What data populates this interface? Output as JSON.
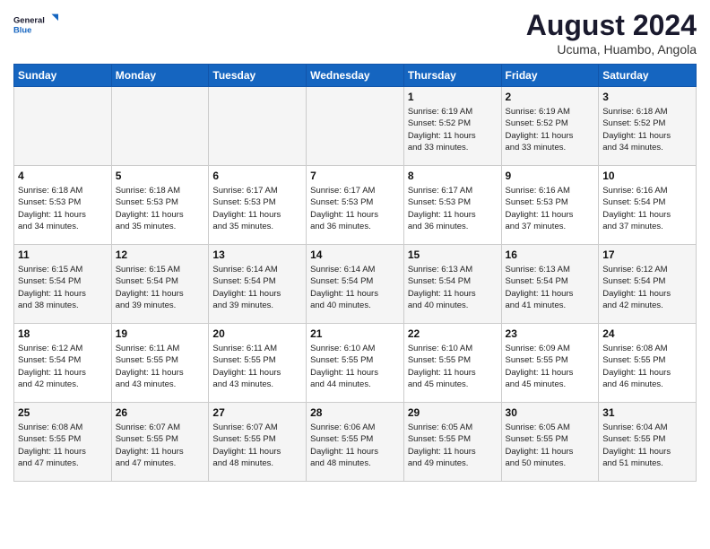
{
  "logo": {
    "line1": "General",
    "line2": "Blue"
  },
  "title": "August 2024",
  "subtitle": "Ucuma, Huambo, Angola",
  "days": [
    "Sunday",
    "Monday",
    "Tuesday",
    "Wednesday",
    "Thursday",
    "Friday",
    "Saturday"
  ],
  "weeks": [
    [
      {
        "day": "",
        "text": ""
      },
      {
        "day": "",
        "text": ""
      },
      {
        "day": "",
        "text": ""
      },
      {
        "day": "",
        "text": ""
      },
      {
        "day": "1",
        "text": "Sunrise: 6:19 AM\nSunset: 5:52 PM\nDaylight: 11 hours\nand 33 minutes."
      },
      {
        "day": "2",
        "text": "Sunrise: 6:19 AM\nSunset: 5:52 PM\nDaylight: 11 hours\nand 33 minutes."
      },
      {
        "day": "3",
        "text": "Sunrise: 6:18 AM\nSunset: 5:52 PM\nDaylight: 11 hours\nand 34 minutes."
      }
    ],
    [
      {
        "day": "4",
        "text": "Sunrise: 6:18 AM\nSunset: 5:53 PM\nDaylight: 11 hours\nand 34 minutes."
      },
      {
        "day": "5",
        "text": "Sunrise: 6:18 AM\nSunset: 5:53 PM\nDaylight: 11 hours\nand 35 minutes."
      },
      {
        "day": "6",
        "text": "Sunrise: 6:17 AM\nSunset: 5:53 PM\nDaylight: 11 hours\nand 35 minutes."
      },
      {
        "day": "7",
        "text": "Sunrise: 6:17 AM\nSunset: 5:53 PM\nDaylight: 11 hours\nand 36 minutes."
      },
      {
        "day": "8",
        "text": "Sunrise: 6:17 AM\nSunset: 5:53 PM\nDaylight: 11 hours\nand 36 minutes."
      },
      {
        "day": "9",
        "text": "Sunrise: 6:16 AM\nSunset: 5:53 PM\nDaylight: 11 hours\nand 37 minutes."
      },
      {
        "day": "10",
        "text": "Sunrise: 6:16 AM\nSunset: 5:54 PM\nDaylight: 11 hours\nand 37 minutes."
      }
    ],
    [
      {
        "day": "11",
        "text": "Sunrise: 6:15 AM\nSunset: 5:54 PM\nDaylight: 11 hours\nand 38 minutes."
      },
      {
        "day": "12",
        "text": "Sunrise: 6:15 AM\nSunset: 5:54 PM\nDaylight: 11 hours\nand 39 minutes."
      },
      {
        "day": "13",
        "text": "Sunrise: 6:14 AM\nSunset: 5:54 PM\nDaylight: 11 hours\nand 39 minutes."
      },
      {
        "day": "14",
        "text": "Sunrise: 6:14 AM\nSunset: 5:54 PM\nDaylight: 11 hours\nand 40 minutes."
      },
      {
        "day": "15",
        "text": "Sunrise: 6:13 AM\nSunset: 5:54 PM\nDaylight: 11 hours\nand 40 minutes."
      },
      {
        "day": "16",
        "text": "Sunrise: 6:13 AM\nSunset: 5:54 PM\nDaylight: 11 hours\nand 41 minutes."
      },
      {
        "day": "17",
        "text": "Sunrise: 6:12 AM\nSunset: 5:54 PM\nDaylight: 11 hours\nand 42 minutes."
      }
    ],
    [
      {
        "day": "18",
        "text": "Sunrise: 6:12 AM\nSunset: 5:54 PM\nDaylight: 11 hours\nand 42 minutes."
      },
      {
        "day": "19",
        "text": "Sunrise: 6:11 AM\nSunset: 5:55 PM\nDaylight: 11 hours\nand 43 minutes."
      },
      {
        "day": "20",
        "text": "Sunrise: 6:11 AM\nSunset: 5:55 PM\nDaylight: 11 hours\nand 43 minutes."
      },
      {
        "day": "21",
        "text": "Sunrise: 6:10 AM\nSunset: 5:55 PM\nDaylight: 11 hours\nand 44 minutes."
      },
      {
        "day": "22",
        "text": "Sunrise: 6:10 AM\nSunset: 5:55 PM\nDaylight: 11 hours\nand 45 minutes."
      },
      {
        "day": "23",
        "text": "Sunrise: 6:09 AM\nSunset: 5:55 PM\nDaylight: 11 hours\nand 45 minutes."
      },
      {
        "day": "24",
        "text": "Sunrise: 6:08 AM\nSunset: 5:55 PM\nDaylight: 11 hours\nand 46 minutes."
      }
    ],
    [
      {
        "day": "25",
        "text": "Sunrise: 6:08 AM\nSunset: 5:55 PM\nDaylight: 11 hours\nand 47 minutes."
      },
      {
        "day": "26",
        "text": "Sunrise: 6:07 AM\nSunset: 5:55 PM\nDaylight: 11 hours\nand 47 minutes."
      },
      {
        "day": "27",
        "text": "Sunrise: 6:07 AM\nSunset: 5:55 PM\nDaylight: 11 hours\nand 48 minutes."
      },
      {
        "day": "28",
        "text": "Sunrise: 6:06 AM\nSunset: 5:55 PM\nDaylight: 11 hours\nand 48 minutes."
      },
      {
        "day": "29",
        "text": "Sunrise: 6:05 AM\nSunset: 5:55 PM\nDaylight: 11 hours\nand 49 minutes."
      },
      {
        "day": "30",
        "text": "Sunrise: 6:05 AM\nSunset: 5:55 PM\nDaylight: 11 hours\nand 50 minutes."
      },
      {
        "day": "31",
        "text": "Sunrise: 6:04 AM\nSunset: 5:55 PM\nDaylight: 11 hours\nand 51 minutes."
      }
    ]
  ]
}
